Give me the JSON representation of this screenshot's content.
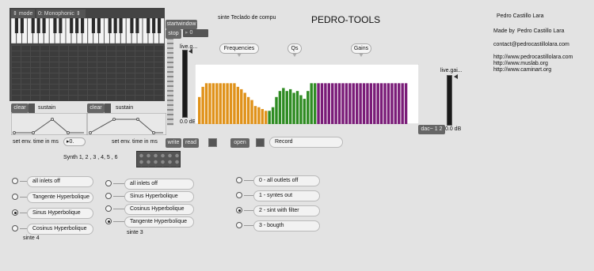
{
  "header": {
    "patch_title": "sinte Teclado de compu",
    "app_title": "PEDRO-TOOLS"
  },
  "credits": {
    "name": "Pedro Castillo Lara",
    "made_by_label": "Made by",
    "made_by_name": "Pedro Castillo Lara",
    "email": "contact@pedrocastillolara.com",
    "links": [
      "http://www.pedrocastillolara.com",
      "http://www.muslab.org",
      "http://www.caminart.org"
    ]
  },
  "keyboard": {
    "mode_label": "mode",
    "mode_value": "0: Monophonic"
  },
  "window_controls": {
    "startwindow": "startwindow",
    "stop": "stop",
    "value": "0"
  },
  "envelopes": {
    "clear_label": "clear",
    "sustain_label": "sustain",
    "set_env_label": "set env. time in ms",
    "set_env_value": "0."
  },
  "meters": {
    "left_label": "live.g...",
    "left_db": "0.0 dB",
    "right_label": "live.gai...",
    "right_db": "0.0 dB"
  },
  "buttons": {
    "write": "write",
    "read": "read",
    "open": "open",
    "record": "Record",
    "dac": "dac~ 1 2"
  },
  "eq": {
    "frequencies_label": "Frequencies",
    "qs_label": "Qs",
    "gains_label": "Gains",
    "colors": {
      "frequencies": "#e0921a",
      "qs": "#2e8b22",
      "gains": "#7a1c78"
    },
    "frequencies": [
      0.45,
      0.62,
      0.68,
      0.68,
      0.68,
      0.68,
      0.68,
      0.68,
      0.68,
      0.68,
      0.68,
      0.62,
      0.58,
      0.52,
      0.45,
      0.4,
      0.3,
      0.28,
      0.25,
      0.22
    ],
    "qs": [
      0.22,
      0.28,
      0.45,
      0.55,
      0.6,
      0.55,
      0.58,
      0.52,
      0.55,
      0.48,
      0.42,
      0.55,
      0.68,
      0.68
    ],
    "gains": [
      0.68,
      0.68,
      0.68,
      0.68,
      0.68,
      0.68,
      0.68,
      0.68,
      0.68,
      0.68,
      0.68,
      0.68,
      0.68,
      0.68,
      0.68,
      0.68,
      0.68,
      0.68,
      0.68,
      0.68,
      0.68,
      0.68,
      0.68,
      0.68,
      0.68,
      0.68
    ]
  },
  "synth_caption": "Synth 1, 2 , 3 , 4, 5 , 6",
  "sinte4": {
    "caption": "sinte 4",
    "options": [
      "all inlets off",
      "Tangente Hyperbolique",
      "Sinus Hyperbolique",
      "Cosinus Hyperbolique"
    ],
    "selected": 2
  },
  "sinte3": {
    "caption": "sinte 3",
    "options": [
      "all inlets off",
      "Sinus Hyperbolique",
      "Cosinus Hyperbolique",
      "Tangente Hyperbolique"
    ],
    "selected": 3
  },
  "outlets": {
    "options": [
      "0 - all outlets off",
      "1 - syntes out",
      "2 - sint with filter",
      "3 - bougth"
    ],
    "selected": 2
  }
}
